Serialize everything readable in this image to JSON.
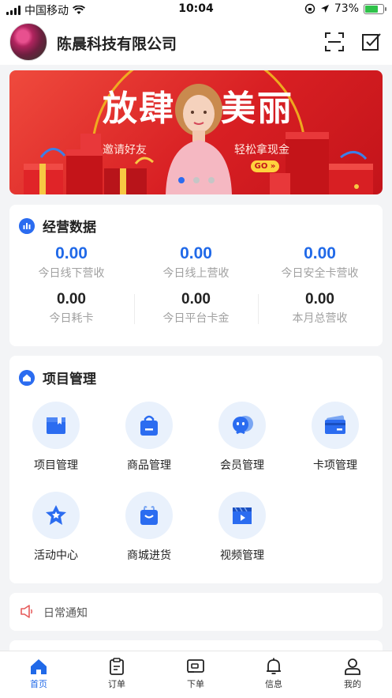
{
  "status_bar": {
    "carrier": "中国移动",
    "time": "10:04",
    "battery": "73%"
  },
  "header": {
    "company_name": "陈晨科技有限公司",
    "scan_icon": "scan-icon",
    "checklist_icon": "checklist-icon"
  },
  "banner": {
    "headline_left": "放肆",
    "headline_right": "美丽",
    "subtitle_left": "邀请好友",
    "subtitle_right": "轻松拿现金",
    "go_label": "GO »",
    "active_dot": 0
  },
  "business_data": {
    "title": "经营数据",
    "row1": [
      {
        "value": "0.00",
        "label": "今日线下营收"
      },
      {
        "value": "0.00",
        "label": "今日线上营收"
      },
      {
        "value": "0.00",
        "label": "今日安全卡营收"
      }
    ],
    "row2": [
      {
        "value": "0.00",
        "label": "今日耗卡"
      },
      {
        "value": "0.00",
        "label": "今日平台卡金"
      },
      {
        "value": "0.00",
        "label": "本月总营收"
      }
    ]
  },
  "project_management": {
    "title": "项目管理",
    "items": [
      {
        "label": "项目管理",
        "icon": "project-icon"
      },
      {
        "label": "商品管理",
        "icon": "shopping-bag-icon"
      },
      {
        "label": "会员管理",
        "icon": "member-icon"
      },
      {
        "label": "卡项管理",
        "icon": "card-icon"
      },
      {
        "label": "活动中心",
        "icon": "star-icon"
      },
      {
        "label": "商城进货",
        "icon": "basket-icon"
      },
      {
        "label": "视频管理",
        "icon": "video-icon"
      }
    ]
  },
  "notice": {
    "label": "日常通知",
    "icon": "megaphone-icon"
  },
  "tabbar": {
    "items": [
      {
        "label": "首页",
        "icon": "home-icon"
      },
      {
        "label": "订单",
        "icon": "clipboard-icon"
      },
      {
        "label": "下单",
        "icon": "card-order-icon"
      },
      {
        "label": "信息",
        "icon": "bell-icon"
      },
      {
        "label": "我的",
        "icon": "user-icon"
      }
    ]
  },
  "colors": {
    "accent": "#2069e8",
    "banner_red": "#d81f23",
    "icon_bg": "#e9f1fc"
  }
}
